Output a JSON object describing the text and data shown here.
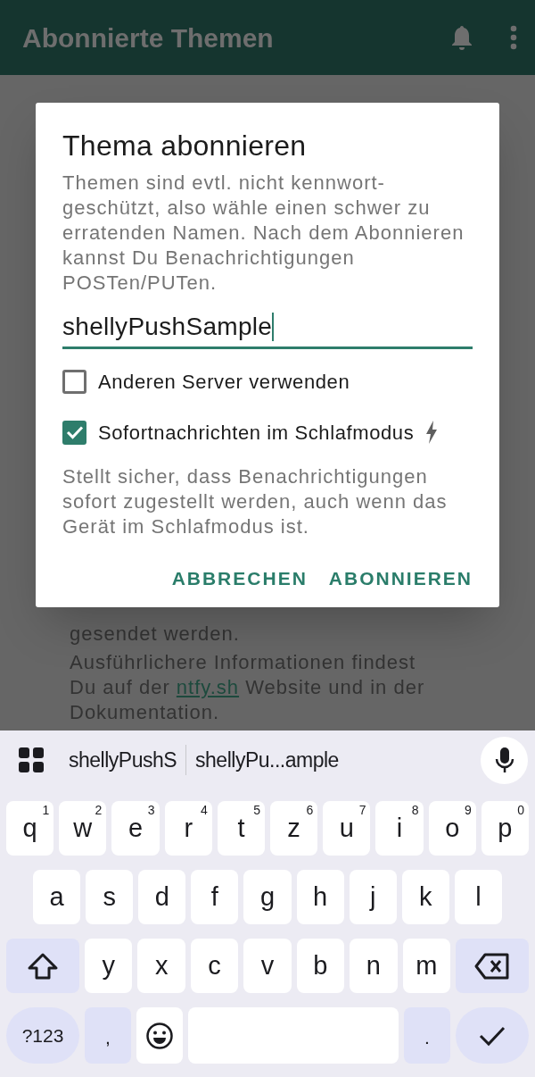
{
  "app_bar": {
    "title": "Abonnierte Themen"
  },
  "background": {
    "lines_top": "gesendet werden.",
    "paragraph_before": "Ausführlichere Informationen findest Du auf der",
    "link": "ntfy.sh",
    "paragraph_after": "Website und in der Dokumentation."
  },
  "dialog": {
    "title": "Thema abonnieren",
    "description": "Themen sind evtl. nicht kennwort-geschützt, also wähle einen schwer zu erratenden Namen. Nach dem Abonnieren kannst Du Benachrichtigungen POSTen/PUTen.",
    "topic_field": {
      "value": "shellyPushSample"
    },
    "options": [
      {
        "label": "Anderen Server verwenden",
        "checked": false,
        "bolt": false
      },
      {
        "label": "Sofortnachrichten im Schlafmodus",
        "checked": true,
        "bolt": true
      }
    ],
    "help": "Stellt sicher, dass Benachrichtigungen sofort zugestellt werden, auch wenn das Gerät im Schlafmodus ist.",
    "buttons": [
      "ABBRECHEN",
      "ABONNIEREN"
    ]
  },
  "keyboard": {
    "suggestions": [
      "shellyPushS",
      "shellyPu...ample"
    ],
    "rows": [
      {
        "keys": [
          {
            "kind": "letter",
            "label": "q",
            "hint": "1"
          },
          {
            "kind": "letter",
            "label": "w",
            "hint": "2"
          },
          {
            "kind": "letter",
            "label": "e",
            "hint": "3"
          },
          {
            "kind": "letter",
            "label": "r",
            "hint": "4"
          },
          {
            "kind": "letter",
            "label": "t",
            "hint": "5"
          },
          {
            "kind": "letter",
            "label": "z",
            "hint": "6"
          },
          {
            "kind": "letter",
            "label": "u",
            "hint": "7"
          },
          {
            "kind": "letter",
            "label": "i",
            "hint": "8"
          },
          {
            "kind": "letter",
            "label": "o",
            "hint": "9"
          },
          {
            "kind": "letter",
            "label": "p",
            "hint": "0"
          }
        ]
      },
      {
        "keys": [
          {
            "kind": "letter",
            "label": "a"
          },
          {
            "kind": "letter",
            "label": "s"
          },
          {
            "kind": "letter",
            "label": "d"
          },
          {
            "kind": "letter",
            "label": "f"
          },
          {
            "kind": "letter",
            "label": "g"
          },
          {
            "kind": "letter",
            "label": "h"
          },
          {
            "kind": "letter",
            "label": "j"
          },
          {
            "kind": "letter",
            "label": "k"
          },
          {
            "kind": "letter",
            "label": "l"
          }
        ]
      },
      {
        "keys": [
          {
            "kind": "shift"
          },
          {
            "kind": "letter",
            "label": "y"
          },
          {
            "kind": "letter",
            "label": "x"
          },
          {
            "kind": "letter",
            "label": "c"
          },
          {
            "kind": "letter",
            "label": "v"
          },
          {
            "kind": "letter",
            "label": "b"
          },
          {
            "kind": "letter",
            "label": "n"
          },
          {
            "kind": "letter",
            "label": "m"
          },
          {
            "kind": "backspace"
          }
        ]
      },
      {
        "keys": [
          {
            "kind": "mode",
            "label": "?123"
          },
          {
            "kind": "punct",
            "label": ","
          },
          {
            "kind": "emoji"
          },
          {
            "kind": "space"
          },
          {
            "kind": "punct",
            "label": "."
          },
          {
            "kind": "enter"
          }
        ]
      }
    ]
  }
}
